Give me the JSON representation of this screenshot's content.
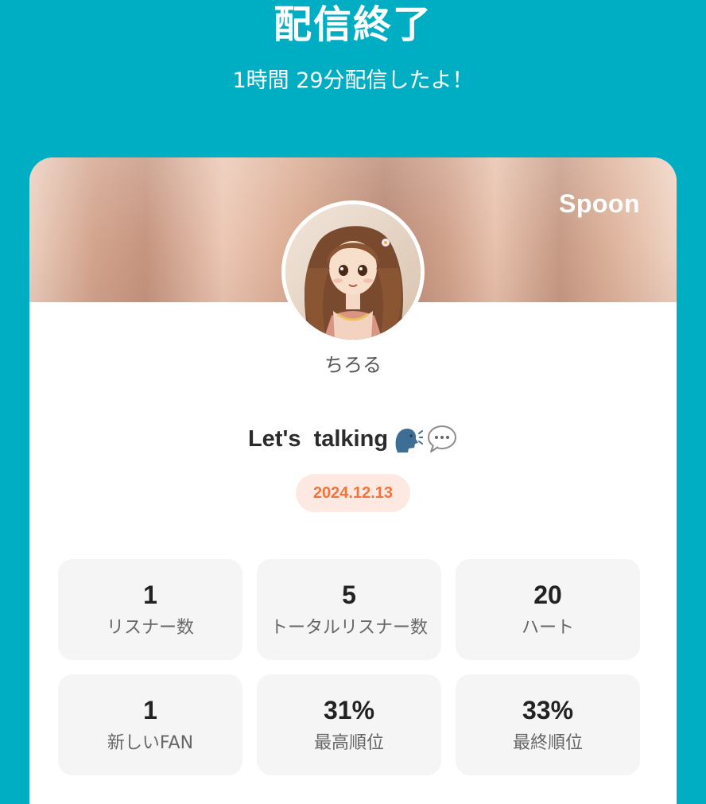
{
  "header": {
    "title": "配信終了",
    "subtitle": "1時間 29分配信したよ！"
  },
  "card": {
    "brand": "Spoon",
    "username": "ちろる",
    "live_title": "Let's  talking",
    "title_emojis": [
      "speaking-head-icon",
      "speech-balloon-icon"
    ],
    "date": "2024.12.13",
    "stats": [
      {
        "value": "1",
        "label": "リスナー数"
      },
      {
        "value": "5",
        "label": "トータルリスナー数"
      },
      {
        "value": "20",
        "label": "ハート"
      },
      {
        "value": "1",
        "label": "新しいFAN"
      },
      {
        "value": "31%",
        "label": "最高順位"
      },
      {
        "value": "33%",
        "label": "最終順位"
      }
    ]
  },
  "colors": {
    "background": "#00aec4",
    "card": "#ffffff",
    "date_text": "#f4733b",
    "date_badge": "#fde9e2",
    "stat_tile": "#f5f5f5"
  }
}
